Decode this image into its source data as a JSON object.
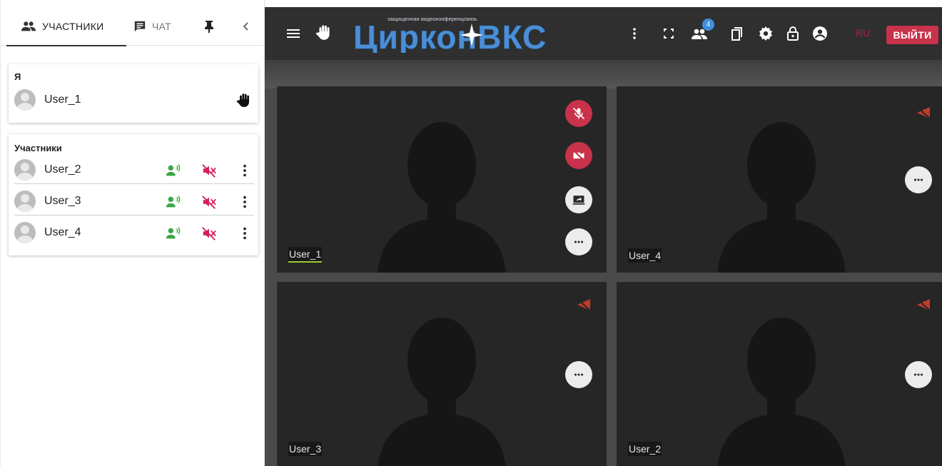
{
  "left_panel": {
    "tabs": {
      "participants_label": "УЧАСТНИКИ",
      "chat_label": "ЧАТ",
      "pin_icon": "pin-icon",
      "collapse_icon": "chevron-left-icon"
    },
    "me_section": {
      "title": "Я",
      "user": {
        "name": "User_1",
        "status_icon": "raised-hand-icon"
      }
    },
    "participants_section": {
      "title": "Участники",
      "users": [
        {
          "name": "User_2"
        },
        {
          "name": "User_3"
        },
        {
          "name": "User_4"
        }
      ],
      "row_icons": [
        "speaking-icon",
        "volume-off-icon",
        "more-vert-icon"
      ]
    }
  },
  "topbar": {
    "logo_tagline": "защищенная видеоконференцсвязь",
    "logo_text": "ЦирконВКС",
    "participants_count": "4",
    "language": "RU",
    "logout_label": "ВЫЙТИ"
  },
  "tiles": [
    {
      "name": "User_1",
      "active": true,
      "controls": [
        "mic-off-icon",
        "camera-off-icon",
        "screen-share-icon",
        "more-horiz-icon"
      ]
    },
    {
      "name": "User_4",
      "controls": [
        "no-video-indicator-icon",
        "more-horiz-icon"
      ]
    },
    {
      "name": "User_3",
      "controls": [
        "no-video-indicator-icon",
        "more-horiz-icon"
      ]
    },
    {
      "name": "User_2",
      "controls": [
        "no-video-indicator-icon",
        "more-horiz-icon"
      ]
    }
  ],
  "colors": {
    "accent_red": "#c8324a",
    "speaking_green": "#3aa745",
    "muted_red": "#d81b60",
    "badge_blue": "#3d8fe0",
    "logo_blue": "#4a8fd6",
    "active_underline": "#9acd32"
  }
}
